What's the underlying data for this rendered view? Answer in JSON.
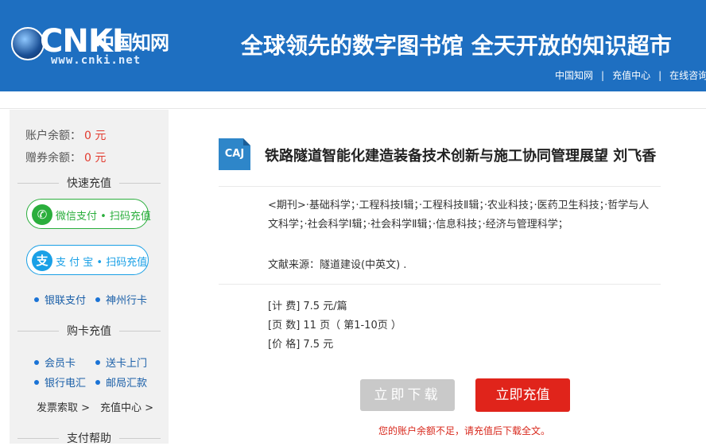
{
  "header": {
    "logo_text": "CNKI",
    "logo_cn": "中国知网",
    "logo_url": "www.cnki.net",
    "slogan": "全球领先的数字图书馆  全天开放的知识超市",
    "nav": [
      "中国知网",
      "充值中心",
      "在线咨询"
    ]
  },
  "sidebar": {
    "balance_label": "账户余额：",
    "balance_value": "0 元",
    "voucher_label": "赠券余额：",
    "voucher_value": "0 元",
    "quick_title": "快速充值",
    "wechat_btn": "微信支付 • 扫码充值",
    "alipay_btn": "支 付 宝 • 扫码充值",
    "unionpay": "银联支付",
    "shenzhou": "神州行卡",
    "card_title": "购卡充值",
    "member_card": "会员卡",
    "delivery": "送卡上门",
    "bank_transfer": "银行电汇",
    "postal": "邮局汇款",
    "invoice": "发票索取 >",
    "recharge_center": "充值中心 >",
    "help_title": "支付帮助"
  },
  "document": {
    "format_badge": "CAJ",
    "title": "铁路隧道智能化建造装备技术创新与施工协同管理展望 刘飞香",
    "categories": "<期刊>·基础科学；·工程科技Ⅰ辑；·工程科技Ⅱ辑；·农业科技；·医药卫生科技；·哲学与人文科学；·社会科学Ⅰ辑；·社会科学Ⅱ辑；·信息科技；·经济与管理科学；",
    "source": "文献来源：隧道建设(中英文) .",
    "fee": "[计 费] 7.5 元/篇",
    "pages": "[页 数] 11 页（ 第1-10页 ）",
    "price": "[价 格] 7.5 元"
  },
  "actions": {
    "download_label": "立即下载",
    "recharge_label": "立即充值",
    "notice": "您的账户余额不足，请充值后下载全文。"
  },
  "colors": {
    "header_bg": "#1e6fc1",
    "accent_red": "#e0241b",
    "wechat_green": "#2aae3c",
    "alipay_blue": "#1aa0e6"
  }
}
